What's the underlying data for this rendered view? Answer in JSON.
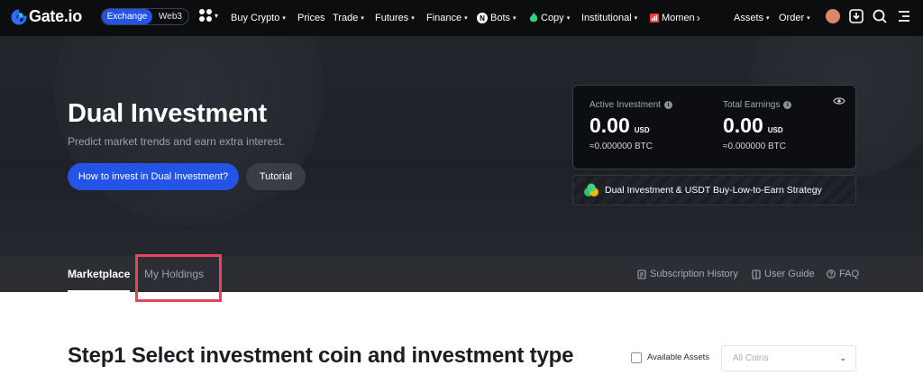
{
  "nav": {
    "brand": "Gate.io",
    "segment": {
      "active": "Exchange",
      "inactive": "Web3"
    },
    "grid_caret": "▾",
    "caret": "▾",
    "items": [
      {
        "label": "Buy Crypto",
        "has_caret": true
      },
      {
        "label": "Prices",
        "has_caret": false
      },
      {
        "label": "Trade",
        "has_caret": true
      },
      {
        "label": "Futures",
        "has_caret": true
      },
      {
        "label": "Finance",
        "has_caret": true
      },
      {
        "label": "Bots",
        "has_caret": true,
        "icon": "bots-icon",
        "icon_glyph": "N"
      },
      {
        "label": "Copy",
        "has_caret": true,
        "icon": "copy-flame-icon"
      },
      {
        "label": "Institutional",
        "has_caret": true
      },
      {
        "label": "Momen",
        "has_caret": false,
        "icon": "momentum-chart-icon",
        "more_glyph": "›"
      }
    ],
    "right": [
      {
        "label": "Assets",
        "has_caret": true
      },
      {
        "label": "Order",
        "has_caret": true
      }
    ],
    "icons": [
      "avatar",
      "download-icon",
      "search-icon",
      "menu-icon"
    ]
  },
  "hero": {
    "title": "Dual Investment",
    "subtitle": "Predict market trends and earn extra interest.",
    "primary_button": "How to invest in Dual Investment?",
    "secondary_button": "Tutorial",
    "stats": {
      "active": {
        "label": "Active Investment",
        "value": "0.00",
        "unit": "USD",
        "btc": "≈0.000000 BTC"
      },
      "earnings": {
        "label": "Total Earnings",
        "value": "0.00",
        "unit": "USD",
        "btc": "≈0.000000 BTC"
      },
      "info_glyph": "i"
    },
    "banner": "Dual Investment & USDT Buy-Low-to-Earn Strategy"
  },
  "tabs": {
    "items": [
      "Marketplace",
      "My Holdings"
    ],
    "active_index": 0,
    "links": [
      "Subscription History",
      "User Guide",
      "FAQ"
    ]
  },
  "step": {
    "title": "Step1 Select investment coin and investment type",
    "checkbox_label": "Available Assets",
    "checkbox_checked": false,
    "select_placeholder": "All Coins",
    "select_chevron": "⌄"
  },
  "colors": {
    "accent_blue": "#2354e6",
    "nav_bg": "#0c0d0f",
    "highlight_red": "#e0475b"
  }
}
